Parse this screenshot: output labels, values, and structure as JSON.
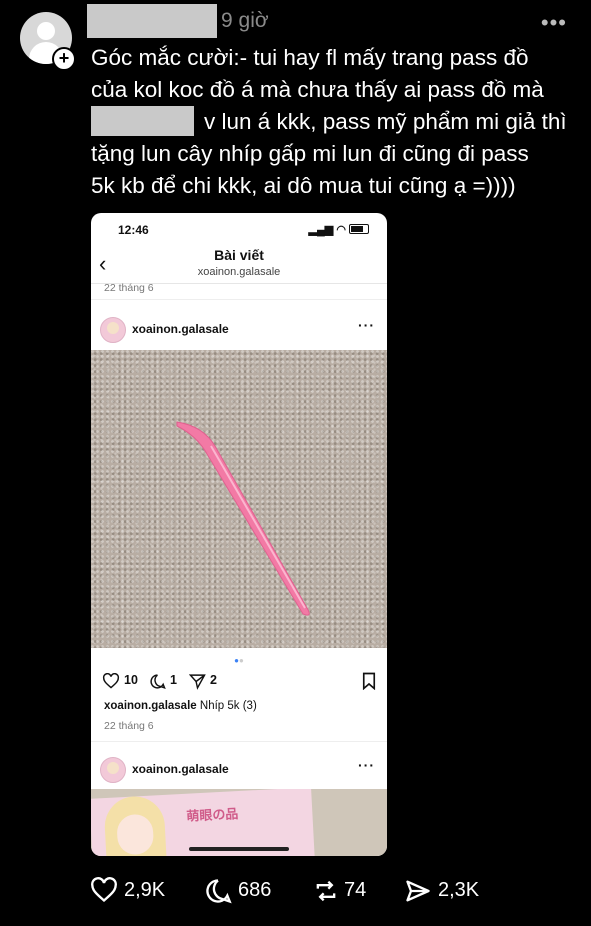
{
  "author": {
    "time": "9 giờ"
  },
  "post": {
    "line1": "Góc mắc cười:- tui hay fl mấy trang pass đồ",
    "line2": "của kol koc đồ á mà chưa thấy ai pass đồ mà",
    "line3_after": "v lun á kkk, pass mỹ phẩm mi giả thì",
    "line4": "tặng lun cây nhíp gấp mi lun đi cũng đi pass",
    "line5": "5k kb để chi kkk, ai dô mua tui cũng ạ =))))"
  },
  "screenshot": {
    "clock": "12:46",
    "nav_title": "Bài viết",
    "nav_sub": "xoainon.galasale",
    "date_top": "22 tháng 6",
    "post1": {
      "username": "xoainon.galasale",
      "likes": "10",
      "comments": "1",
      "shares": "2",
      "caption_user": "xoainon.galasale",
      "caption_text": "Nhíp 5k (3)",
      "date": "22 tháng 6"
    },
    "post2": {
      "username": "xoainon.galasale",
      "card_title": "萌眼の品"
    }
  },
  "bottom_bar": {
    "likes": "2,9K",
    "comments": "686",
    "reposts": "74",
    "shares": "2,3K"
  },
  "colors": {
    "tweezer": "#f27aa5",
    "carpet": "#b8ada3"
  }
}
